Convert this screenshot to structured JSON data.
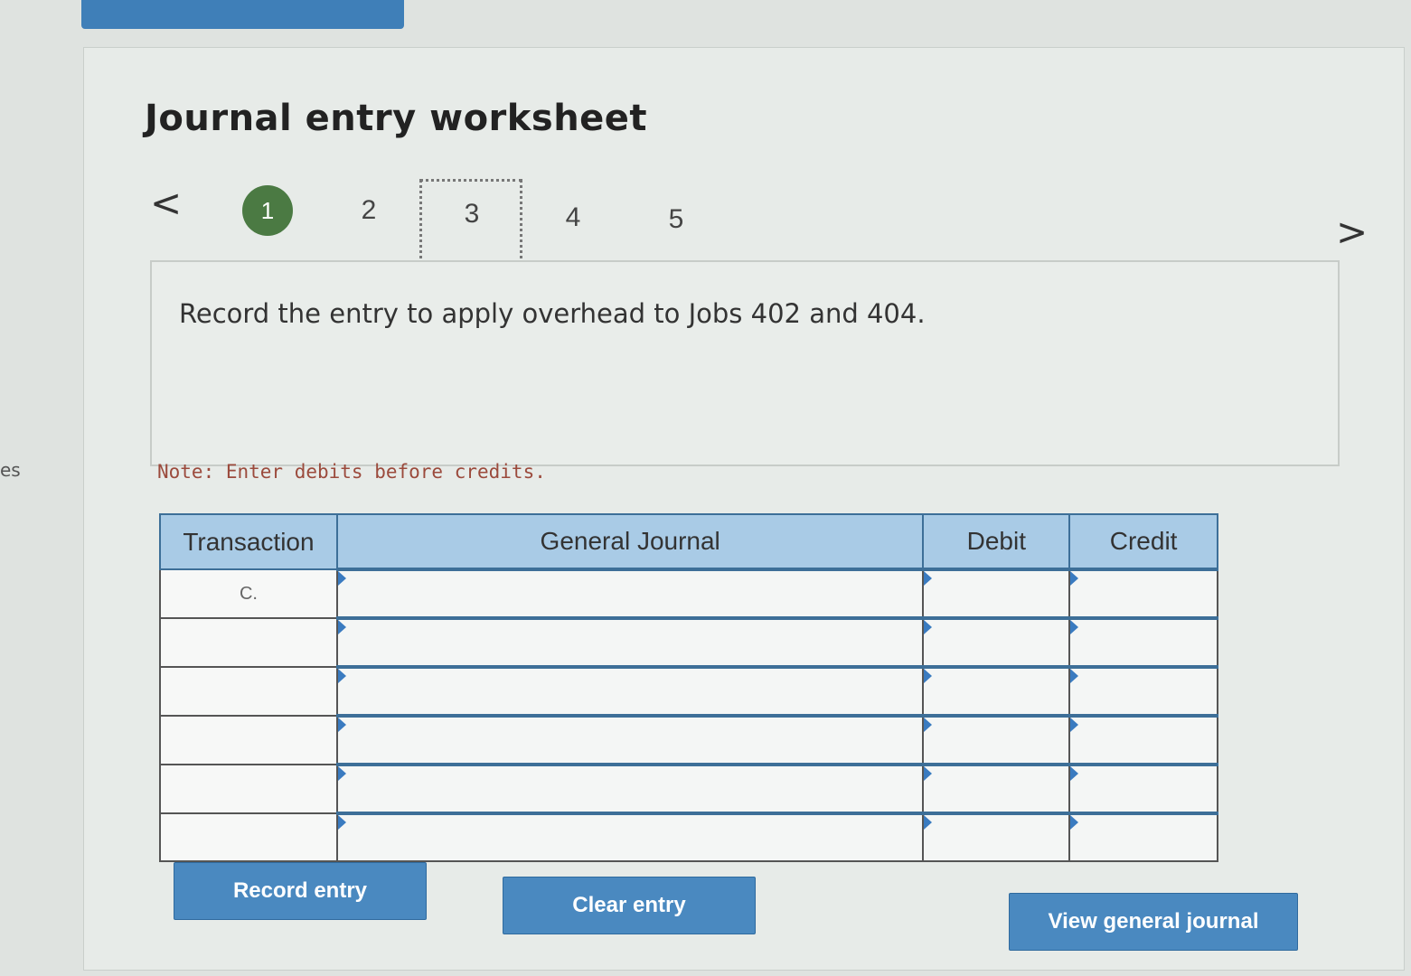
{
  "edge_text": "es",
  "title": "Journal entry worksheet",
  "nav": {
    "prev_glyph": "<",
    "next_glyph": ">",
    "steps": [
      "1",
      "2",
      "3",
      "4",
      "5"
    ]
  },
  "prompt": "Record the entry to apply overhead to Jobs 402 and 404.",
  "note": "Note: Enter debits before credits.",
  "table": {
    "headers": [
      "Transaction",
      "General Journal",
      "Debit",
      "Credit"
    ],
    "rows": [
      {
        "transaction": "C.",
        "account": "",
        "debit": "",
        "credit": ""
      },
      {
        "transaction": "",
        "account": "",
        "debit": "",
        "credit": ""
      },
      {
        "transaction": "",
        "account": "",
        "debit": "",
        "credit": ""
      },
      {
        "transaction": "",
        "account": "",
        "debit": "",
        "credit": ""
      },
      {
        "transaction": "",
        "account": "",
        "debit": "",
        "credit": ""
      },
      {
        "transaction": "",
        "account": "",
        "debit": "",
        "credit": ""
      }
    ]
  },
  "buttons": {
    "record": "Record entry",
    "clear": "Clear entry",
    "view": "View general journal"
  },
  "colors": {
    "active_step": "#4b7a43",
    "header_bg": "#a9cbe6",
    "button_bg": "#4a89c0",
    "note_text": "#9b4a3c"
  }
}
